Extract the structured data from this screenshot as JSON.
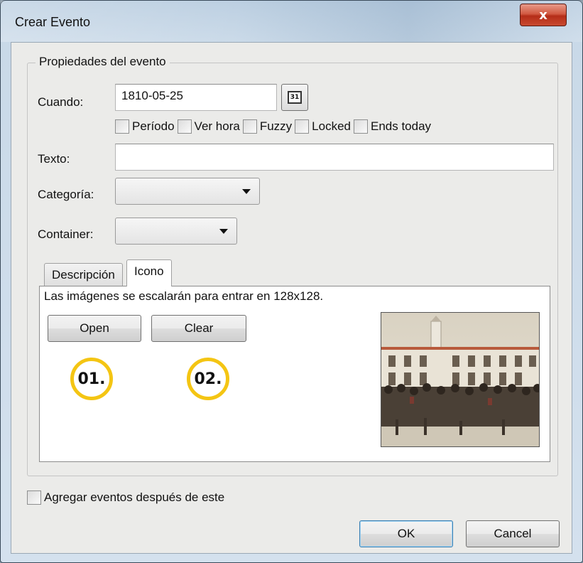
{
  "window": {
    "title": "Crear Evento",
    "close_label": "x"
  },
  "group": {
    "legend": "Propiedades del evento"
  },
  "cuando": {
    "label": "Cuando:",
    "value": "1810-05-25",
    "calendar_icon_text": "31"
  },
  "checkboxes": [
    {
      "label": "Período",
      "checked": false
    },
    {
      "label": "Ver hora",
      "checked": false
    },
    {
      "label": "Fuzzy",
      "checked": false
    },
    {
      "label": "Locked",
      "checked": false
    },
    {
      "label": "Ends today",
      "checked": false
    }
  ],
  "texto": {
    "label": "Texto:",
    "value": ""
  },
  "categoria": {
    "label": "Categoría:",
    "selected": ""
  },
  "container": {
    "label": "Container:",
    "selected": ""
  },
  "tabs": [
    {
      "label": "Descripción",
      "active": false
    },
    {
      "label": "Icono",
      "active": true
    }
  ],
  "icono_panel": {
    "hint": "Las imágenes se escalarán para entrar en 128x128.",
    "open_label": "Open",
    "clear_label": "Clear",
    "image_icon": "painting-icon"
  },
  "annotations": {
    "badge1": "01.",
    "badge2": "02."
  },
  "footer": {
    "add_after_label": "Agregar eventos después de este",
    "add_after_checked": false,
    "ok_label": "OK",
    "cancel_label": "Cancel"
  },
  "colors": {
    "badge_ring": "#f4c513",
    "close_button": "#c84a30",
    "default_button_border": "#3c7fb1"
  }
}
